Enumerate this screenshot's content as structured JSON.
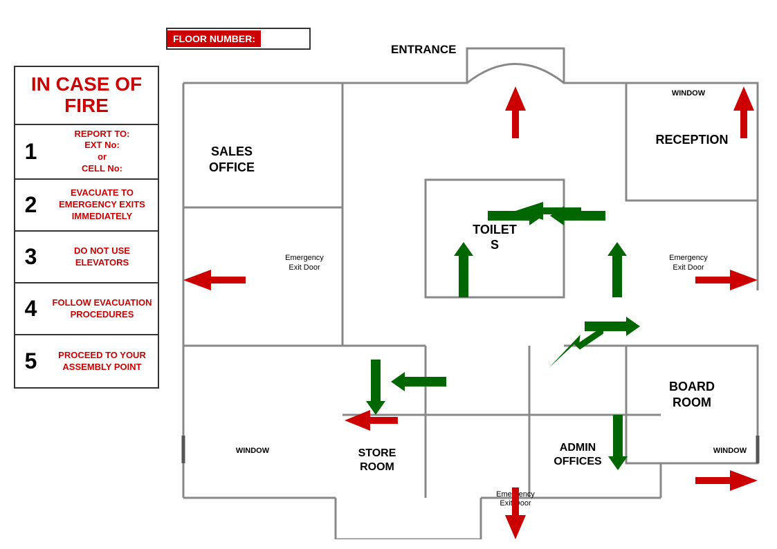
{
  "floor_number_label": "FLOOR NUMBER:",
  "floor_number_value": "",
  "entrance_label": "ENTRANCE",
  "left_panel": {
    "title": "IN CASE OF FIRE",
    "steps": [
      {
        "num": "1",
        "text": "REPORT TO:\nEXT No:\nor\nCELL No:"
      },
      {
        "num": "2",
        "text": "EVACUATE TO EMERGENCY EXITS IMMEDIATELY"
      },
      {
        "num": "3",
        "text": "DO NOT USE ELEVATORS"
      },
      {
        "num": "4",
        "text": "FOLLOW EVACUATION PROCEDURES"
      },
      {
        "num": "5",
        "text": "PROCEED TO YOUR ASSEMBLY POINT"
      }
    ]
  },
  "rooms": {
    "sales_office": "SALES OFFICE",
    "toilets": "TOILET S",
    "reception": "RECEPTION",
    "board_room": "BOARD ROOM",
    "store_room": "STORE ROOM",
    "admin_offices": "ADMIN OFFICES"
  },
  "labels": {
    "emergency_exit_door": "Emergency Exit Door",
    "window": "WINDOW"
  }
}
